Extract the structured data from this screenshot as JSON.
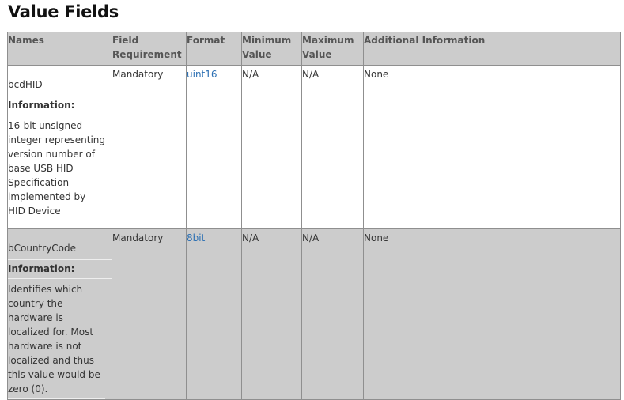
{
  "title": "Value Fields",
  "headers": {
    "names": "Names",
    "field_requirement": "Field Requirement",
    "format": "Format",
    "minimum_value": "Minimum Value",
    "maximum_value": "Maximum Value",
    "additional_information": "Additional Information"
  },
  "rows": [
    {
      "name": "bcdHID",
      "info_label": "Information:",
      "info_text": "16-bit unsigned integer representing version number of base USB HID Specification implemented by HID Device",
      "requirement": "Mandatory",
      "format": "uint16",
      "minimum": "N/A",
      "maximum": "N/A",
      "additional": "None"
    },
    {
      "name": "bCountryCode",
      "info_label": "Information:",
      "info_text": "Identifies which country the hardware is localized for. Most hardware is not localized and thus this value would be zero (0).",
      "requirement": "Mandatory",
      "format": "8bit",
      "minimum": "N/A",
      "maximum": "N/A",
      "additional": "None"
    }
  ],
  "colors": {
    "header_bg": "#cccccc",
    "row_alt_bg": "#cccccc",
    "link": "#2b6fb3",
    "border": "#8f8f8f"
  }
}
